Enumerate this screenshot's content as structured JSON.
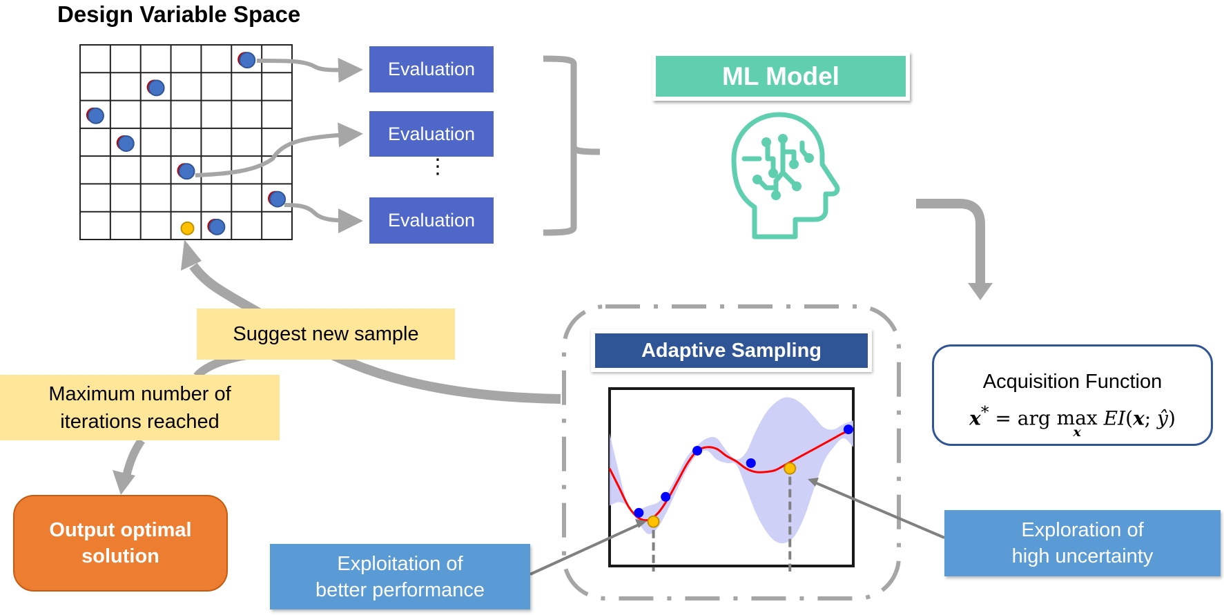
{
  "title": "Design Variable Space",
  "grid": {
    "rows": 7,
    "cols": 7,
    "samples": [
      {
        "col": 5,
        "row": 0,
        "kind": "evaluated"
      },
      {
        "col": 2,
        "row": 1,
        "kind": "evaluated"
      },
      {
        "col": 0,
        "row": 2,
        "kind": "evaluated"
      },
      {
        "col": 1,
        "row": 3,
        "kind": "evaluated"
      },
      {
        "col": 3,
        "row": 4,
        "kind": "evaluated"
      },
      {
        "col": 6,
        "row": 5,
        "kind": "evaluated"
      },
      {
        "col": 4,
        "row": 6,
        "kind": "evaluated"
      },
      {
        "col": 3,
        "row": 6,
        "kind": "new"
      }
    ],
    "colors": {
      "evaluated": "#4472C4",
      "evaluated_edge": "#2F5597",
      "shadow": "#C00000",
      "new": "#FFC000",
      "new_edge": "#BF9000"
    }
  },
  "evaluations": [
    {
      "label": "Evaluation"
    },
    {
      "label": "Evaluation"
    },
    {
      "label": "Evaluation"
    }
  ],
  "ellipsis": "⋮",
  "ml_model": {
    "label": "ML Model",
    "icon": "brain-circuit-head-icon",
    "color": "#5FCFB0"
  },
  "acquisition": {
    "title": "Acquisition Function",
    "formula": {
      "lhs": "x",
      "star": "*",
      "eq": " = arg ",
      "max": "max",
      "sub": "x",
      "fn": "EI",
      "args_open": "(",
      "arg_x": "x",
      "semi": "; ",
      "yhat": "ŷ",
      "args_close": ")"
    }
  },
  "adaptive_sampling": {
    "label": "Adaptive Sampling"
  },
  "labels": {
    "suggest": "Suggest new sample",
    "max_iter": "Maximum number of\niterations reached",
    "output": "Output optimal\nsolution",
    "exploitation": "Exploitation of\nbetter performance",
    "exploration": "Exploration of\nhigh uncertainty"
  },
  "colors": {
    "arrow": "#A6A6A6",
    "eval_box": "#4F67C8",
    "banner": "#2F5597",
    "yellow": "#FFE699",
    "orange": "#ED7D31",
    "blue_callout": "#5B9BD5",
    "mean_curve": "#FF0000",
    "band": "#C9CBF7",
    "observed_point": "#0000FF",
    "candidate_point": "#FFC000"
  },
  "chart_data": {
    "type": "line",
    "title": "Adaptive Sampling",
    "xlabel": "",
    "ylabel": "",
    "xlim": [
      0,
      1
    ],
    "ylim": [
      0,
      1
    ],
    "grid": false,
    "series": [
      {
        "name": "posterior mean",
        "x": [
          0.0,
          0.04,
          0.08,
          0.12,
          0.16,
          0.2,
          0.24,
          0.28,
          0.32,
          0.36,
          0.4,
          0.44,
          0.48,
          0.52,
          0.56,
          0.6,
          0.64,
          0.68,
          0.72,
          0.76,
          0.8,
          0.84,
          0.88,
          0.92,
          0.96,
          1.0
        ],
        "y": [
          0.55,
          0.44,
          0.33,
          0.27,
          0.26,
          0.3,
          0.38,
          0.48,
          0.58,
          0.65,
          0.67,
          0.66,
          0.62,
          0.59,
          0.55,
          0.53,
          0.53,
          0.54,
          0.57,
          0.6,
          0.63,
          0.66,
          0.69,
          0.72,
          0.75,
          0.77
        ]
      },
      {
        "name": "uncertainty band upper",
        "x": [
          0.0,
          0.04,
          0.08,
          0.12,
          0.16,
          0.2,
          0.24,
          0.28,
          0.32,
          0.36,
          0.4,
          0.44,
          0.48,
          0.52,
          0.56,
          0.6,
          0.64,
          0.68,
          0.72,
          0.76,
          0.8,
          0.84,
          0.88,
          0.92,
          0.96,
          1.0
        ],
        "y": [
          0.75,
          0.52,
          0.33,
          0.32,
          0.34,
          0.36,
          0.42,
          0.52,
          0.62,
          0.68,
          0.72,
          0.72,
          0.65,
          0.6,
          0.64,
          0.76,
          0.86,
          0.92,
          0.95,
          0.94,
          0.9,
          0.84,
          0.78,
          0.77,
          0.8,
          0.82
        ]
      },
      {
        "name": "uncertainty band lower",
        "x": [
          0.0,
          0.04,
          0.08,
          0.12,
          0.16,
          0.2,
          0.24,
          0.28,
          0.32,
          0.36,
          0.4,
          0.44,
          0.48,
          0.52,
          0.56,
          0.6,
          0.64,
          0.68,
          0.72,
          0.76,
          0.8,
          0.84,
          0.88,
          0.92,
          0.96,
          1.0
        ],
        "y": [
          0.34,
          0.36,
          0.33,
          0.24,
          0.18,
          0.22,
          0.32,
          0.44,
          0.55,
          0.63,
          0.65,
          0.6,
          0.58,
          0.57,
          0.44,
          0.3,
          0.2,
          0.14,
          0.13,
          0.17,
          0.28,
          0.44,
          0.59,
          0.67,
          0.72,
          0.67
        ]
      },
      {
        "name": "observed samples",
        "x": [
          0.12,
          0.23,
          0.36,
          0.58,
          0.98
        ],
        "y": [
          0.3,
          0.39,
          0.65,
          0.58,
          0.77
        ]
      },
      {
        "name": "candidate samples",
        "x": [
          0.18,
          0.74
        ],
        "y": [
          0.25,
          0.55
        ]
      }
    ]
  }
}
